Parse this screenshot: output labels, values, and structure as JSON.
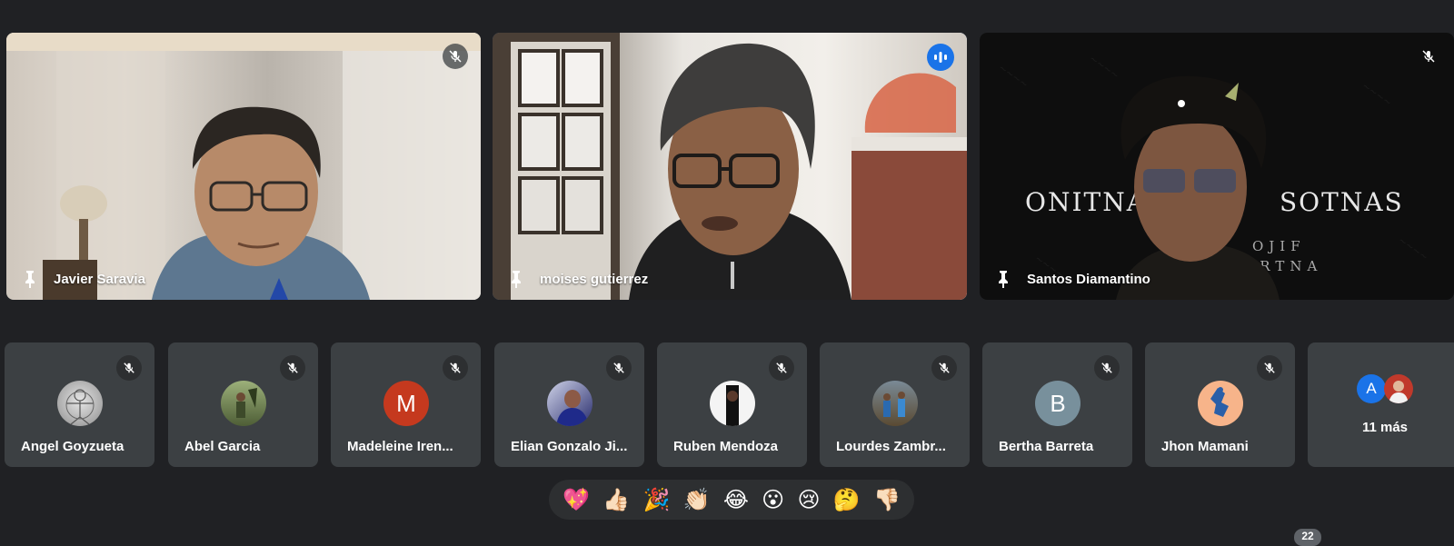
{
  "main_tiles": [
    {
      "name": "Javier Saravia",
      "muted": true
    },
    {
      "name": "moises gutierrez",
      "speaking": true
    },
    {
      "name": "Santos Diamantino",
      "muted": true
    }
  ],
  "participants": [
    {
      "name": "Angel Goyzueta"
    },
    {
      "name": "Abel Garcia"
    },
    {
      "name": "Madeleine Iren...",
      "initial": "M",
      "color": "#c5391e"
    },
    {
      "name": "Elian Gonzalo Ji..."
    },
    {
      "name": "Ruben Mendoza"
    },
    {
      "name": "Lourdes Zambr..."
    },
    {
      "name": "Bertha Barreta",
      "initial": "B",
      "color": "#78909c"
    },
    {
      "name": "Jhon Mamani"
    }
  ],
  "more": {
    "initial": "A",
    "label": "11 más"
  },
  "reactions": [
    "💖",
    "👍🏻",
    "🎉",
    "👏🏻",
    "😂",
    "😮",
    "😢",
    "🤔",
    "👎🏻"
  ],
  "participant_count": "22",
  "colors": {
    "background": "#202124",
    "tile": "#3c4043",
    "speaking_border": "#8ab4f8",
    "accent": "#1a73e8"
  }
}
